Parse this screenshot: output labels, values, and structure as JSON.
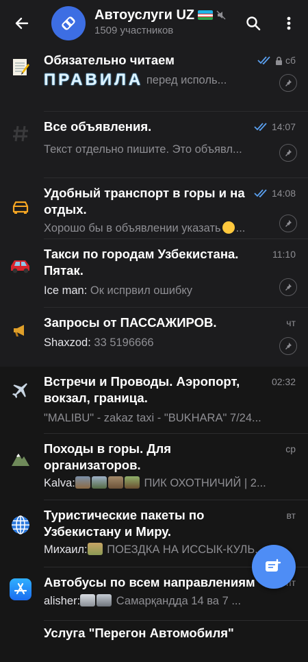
{
  "header": {
    "title": "Автоуслуги UZ",
    "subtitle": "1509 участников"
  },
  "chats": [
    {
      "title": "Обязательно читаем",
      "title2": "ПРАВИЛА",
      "time": "сб",
      "preview": "перед исполь...",
      "read": true,
      "locked": true,
      "pinned": true,
      "icon": "memo-icon"
    },
    {
      "title": "Все объявления.",
      "time": "14:07",
      "preview": "Текст отдельно пишите. Это объявл...",
      "read": true,
      "pinned": true,
      "icon": "hashtag-icon"
    },
    {
      "title": "Удобный транспорт в горы и на отдых.",
      "time": "14:08",
      "preview": "Хорошо бы в объявлении указать",
      "preview_suffix": "...",
      "read": true,
      "pinned": true,
      "icon": "car-outline-icon"
    },
    {
      "title": "Такси по городам Узбекистана. Пятак.",
      "time": "11:10",
      "sender": "Ice man:",
      "preview": "Ок испрвил ошибку",
      "pinned": true,
      "icon": "red-car-icon"
    },
    {
      "title": "Запросы от ПАССАЖИРОВ.",
      "time": "чт",
      "sender": "Shaxzod:",
      "preview": "33 5196666",
      "pinned": true,
      "icon": "megaphone-icon"
    },
    {
      "title": "Встречи и Проводы. Аэропорт, вокзал, граница.",
      "time": "02:32",
      "preview": "\"MALIBU\" - zakaz taxi - \"BUKHARA\" 7/24...",
      "icon": "airplane-icon"
    },
    {
      "title": "Походы в горы. Для организаторов.",
      "time": "ср",
      "sender": "Kalva:",
      "preview": "ПИК ОХОТНИЧИЙ | 2...",
      "icon": "mountain-icon"
    },
    {
      "title": "Туристические пакеты по Узбекистану и Миру.",
      "time": "вт",
      "sender": "Михаил:",
      "preview": "ПОЕЗДКА НА ИССЫК-КУЛЬ...",
      "icon": "globe-icon"
    },
    {
      "title": "Автобусы по всем направлениям",
      "time": "пт",
      "sender": "alisher:",
      "preview": "Самарқандда 14 ва 7 ...",
      "icon": "app-store-icon"
    },
    {
      "title": "Услуга \"Перегон Автомобиля\"",
      "time": "",
      "preview": "",
      "icon": "car-icon"
    }
  ],
  "colors": {
    "accent": "#4e8df5",
    "background": "#161616",
    "header": "#1c1c1e",
    "muted": "#8e8e93",
    "check": "#5aa0f0"
  }
}
